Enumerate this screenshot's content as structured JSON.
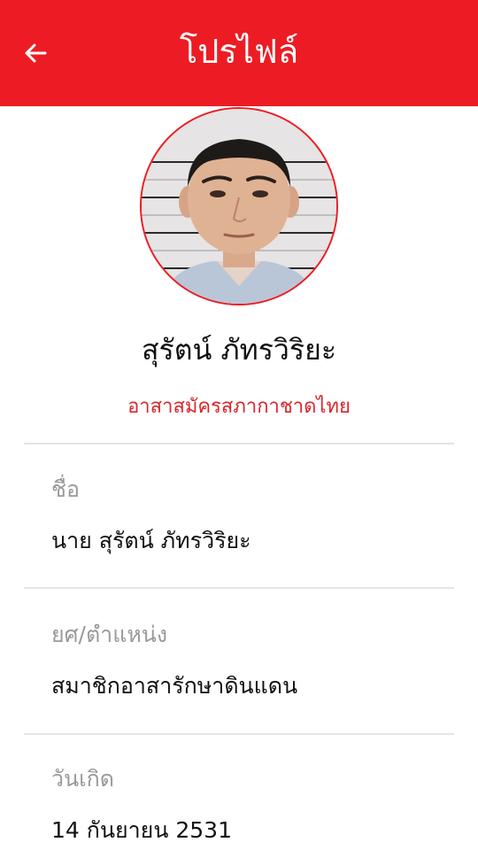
{
  "header": {
    "title": "โปรไฟล์",
    "back_icon": "arrow-left-icon",
    "background": "#ed1c24"
  },
  "profile": {
    "avatar": "person-photo",
    "name": "สุรัตน์ ภัทรวิริยะ",
    "organization": "อาสาสมัครสภากาชาดไทย",
    "accent": "#ed1c24"
  },
  "fields": [
    {
      "label": "ชื่อ",
      "value": "นาย สุรัตน์ ภัทรวิริยะ"
    },
    {
      "label": "ยศ/ตำแหน่ง",
      "value": "สมาชิกอาสารักษาดินแดน"
    },
    {
      "label": "วันเกิด",
      "value": "14 กันยายน 2531"
    }
  ]
}
